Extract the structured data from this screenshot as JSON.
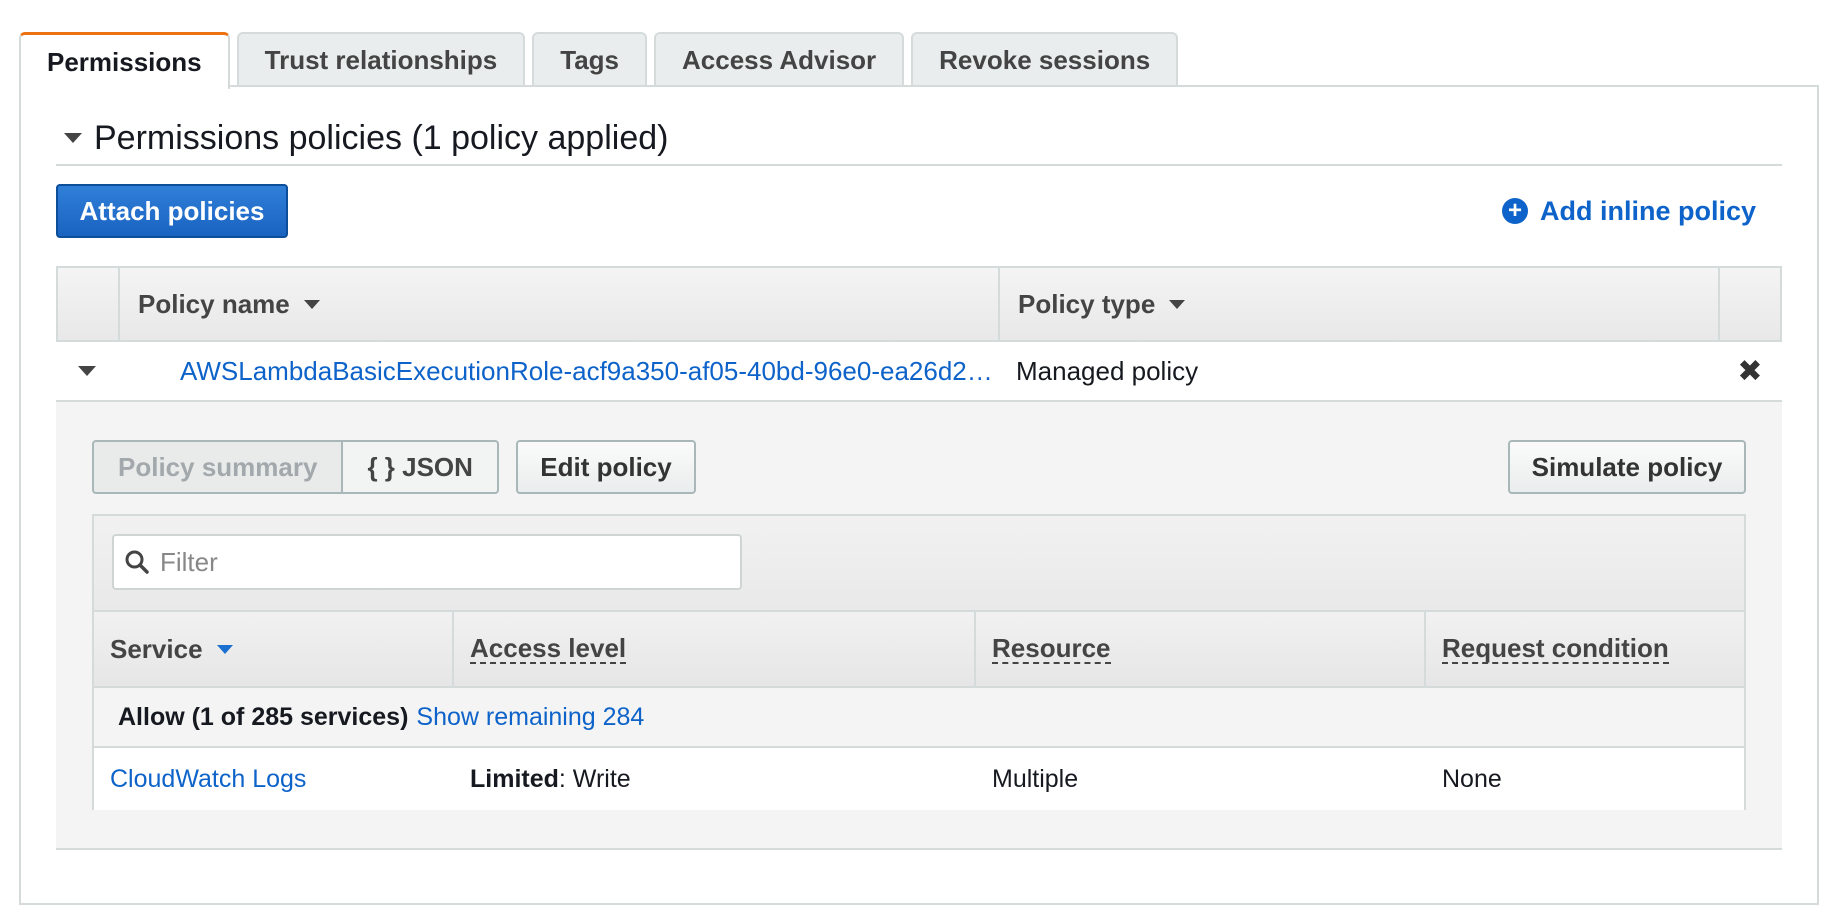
{
  "tabs": [
    {
      "label": "Permissions",
      "active": true
    },
    {
      "label": "Trust relationships",
      "active": false
    },
    {
      "label": "Tags",
      "active": false
    },
    {
      "label": "Access Advisor",
      "active": false
    },
    {
      "label": "Revoke sessions",
      "active": false
    }
  ],
  "section": {
    "title": "Permissions policies (1 policy applied)"
  },
  "actions": {
    "attach_label": "Attach policies",
    "add_inline_label": "Add inline policy"
  },
  "policies_table": {
    "headers": {
      "name": "Policy name",
      "type": "Policy type"
    },
    "rows": [
      {
        "name": "AWSLambdaBasicExecutionRole-acf9a350-af05-40bd-96e0-ea26d2…",
        "type": "Managed policy"
      }
    ]
  },
  "policy_detail": {
    "view_tabs": {
      "summary": "Policy summary",
      "json": "{ } JSON"
    },
    "edit_label": "Edit policy",
    "simulate_label": "Simulate policy",
    "filter_placeholder": "Filter",
    "headers": {
      "service": "Service",
      "access_level": "Access level",
      "resource": "Resource",
      "request_condition": "Request condition"
    },
    "allow_summary": "Allow (1 of 285 services)",
    "show_remaining": "Show remaining 284",
    "services": [
      {
        "service": "CloudWatch Logs",
        "access_prefix": "Limited",
        "access_suffix": ": Write",
        "resource": "Multiple",
        "request_condition": "None"
      }
    ]
  },
  "colors": {
    "accent": "#ec7211",
    "link": "#0d63c9",
    "primary_button": "#1a63c1"
  }
}
